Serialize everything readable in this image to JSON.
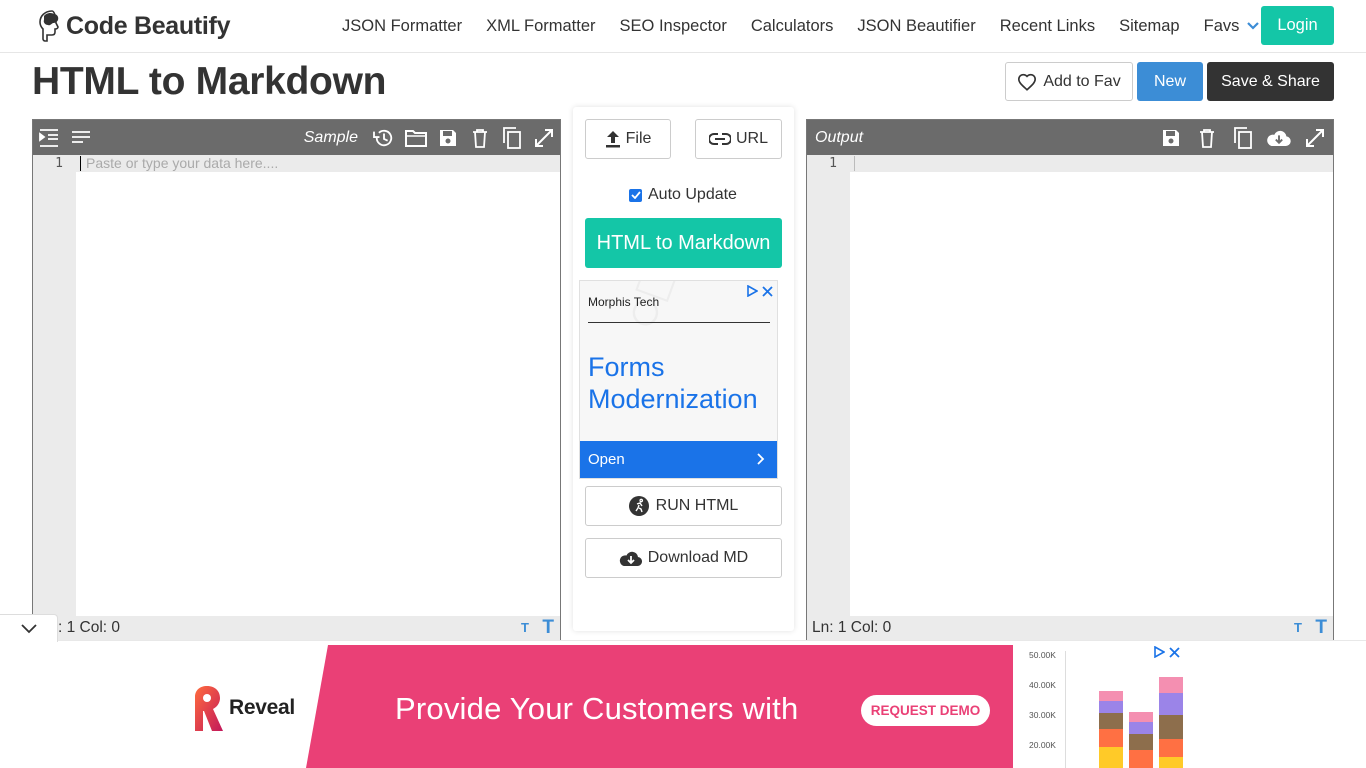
{
  "brand": {
    "name": "Code Beautify"
  },
  "nav": {
    "links": [
      "JSON Formatter",
      "XML Formatter",
      "SEO Inspector",
      "Calculators",
      "JSON Beautifier",
      "Recent Links",
      "Sitemap"
    ],
    "favs": "Favs",
    "login": "Login"
  },
  "page": {
    "title": "HTML to Markdown",
    "add_fav": "Add to Fav",
    "new": "New",
    "save_share": "Save & Share"
  },
  "input_editor": {
    "sample": "Sample",
    "line_number": "1",
    "placeholder": "Paste or type your data here....",
    "status": ": 1 Col: 0"
  },
  "output_editor": {
    "title": "Output",
    "line_number": "1",
    "status": "Ln: 1 Col: 0"
  },
  "middle": {
    "file": "File",
    "url": "URL",
    "auto_update": "Auto Update",
    "auto_update_checked": true,
    "convert": "HTML to Markdown",
    "run_html": "RUN HTML",
    "download": "Download MD"
  },
  "ad_side": {
    "advertiser": "Morphis Tech",
    "headline_1": "Forms",
    "headline_2": "Modernization",
    "cta": "Open"
  },
  "ad_bottom": {
    "brand": "Reveal",
    "tagline": "Provide Your Customers with",
    "cta": "REQUEST DEMO",
    "chart_ticks": [
      "50.00K",
      "40.00K",
      "30.00K",
      "20.00K"
    ]
  },
  "colors": {
    "accent": "#14c6a7",
    "primary": "#3c8dd6",
    "dark": "#333333",
    "toolbar": "#6b6b6b",
    "ad_pink": "#ea4076",
    "ad_blue": "#1a73e8"
  }
}
